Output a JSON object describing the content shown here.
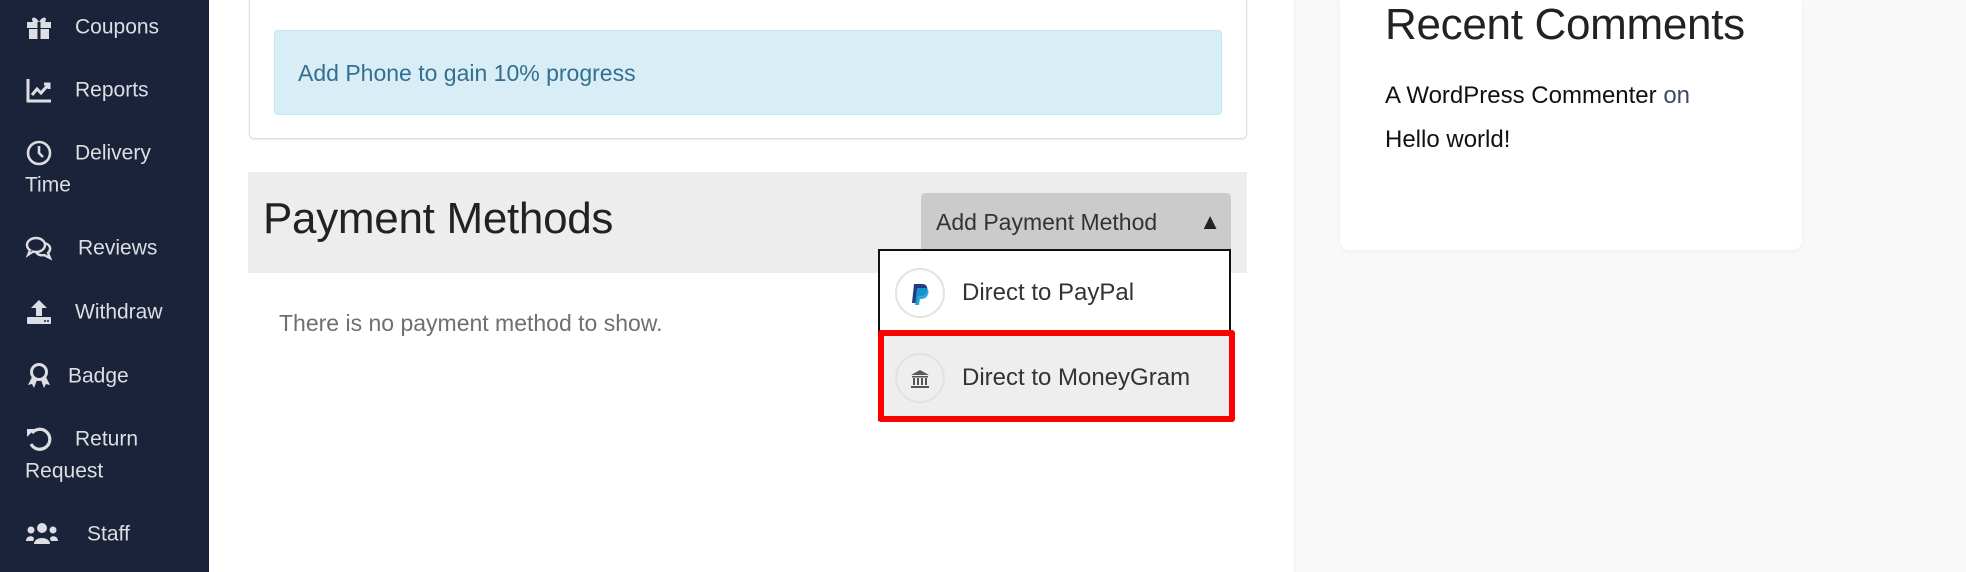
{
  "sidebar": {
    "items": [
      {
        "label": "Coupons",
        "icon": "gift-icon"
      },
      {
        "label": "Reports",
        "icon": "chart-line-icon"
      },
      {
        "label": "Delivery",
        "label_cont": "Time",
        "icon": "clock-icon"
      },
      {
        "label": "Reviews",
        "icon": "comments-icon"
      },
      {
        "label": "Withdraw",
        "icon": "upload-icon"
      },
      {
        "label": "Badge",
        "icon": "award-icon"
      },
      {
        "label": "Return",
        "label_cont": "Request",
        "icon": "undo-icon"
      },
      {
        "label": "Staff",
        "icon": "users-icon"
      }
    ]
  },
  "profile": {
    "alert_text": "Add Phone to gain 10% progress"
  },
  "payment_methods": {
    "title": "Payment Methods",
    "add_button_label": "Add Payment Method",
    "caret": "▲",
    "empty_text": "There is no payment method to show.",
    "dropdown": [
      {
        "label": "Direct to PayPal",
        "icon": "paypal-icon"
      },
      {
        "label": "Direct to MoneyGram",
        "icon": "bank-icon",
        "highlighted": true
      }
    ]
  },
  "recent_comments": {
    "title": "Recent Comments",
    "author": "A WordPress Commenter",
    "connector": "on",
    "post": "Hello world!"
  },
  "colors": {
    "sidebar_bg": "#1b233b",
    "alert_bg": "#d9edf7",
    "alert_text": "#31708f",
    "highlight": "#ff0000",
    "paypal_blue": "#253b80",
    "paypal_light": "#179bd7"
  }
}
